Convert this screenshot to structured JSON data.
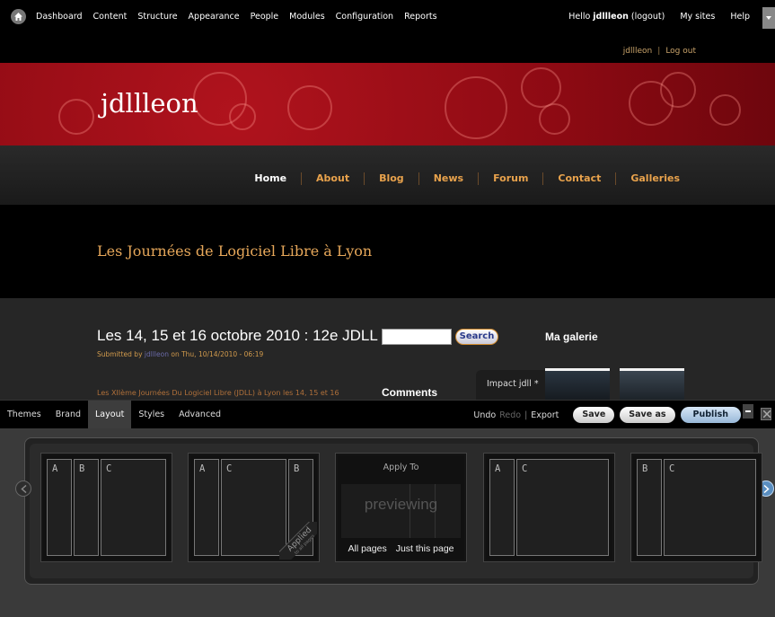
{
  "admin_bar": {
    "menu": [
      "Dashboard",
      "Content",
      "Structure",
      "Appearance",
      "People",
      "Modules",
      "Configuration",
      "Reports"
    ],
    "greeting_prefix": "Hello",
    "username": "jdllleon",
    "logout_paren": "(logout)",
    "my_sites": "My sites",
    "help": "Help"
  },
  "user_links": {
    "user": "jdllleon",
    "separator": "|",
    "logout": "Log out"
  },
  "site": {
    "name": "jdllleon",
    "slogan": "Les Journées de Logiciel Libre à Lyon",
    "nav": [
      "Home",
      "About",
      "Blog",
      "News",
      "Forum",
      "Contact",
      "Galleries"
    ]
  },
  "content": {
    "title": "Les 14, 15 et 16 octobre 2010 : 12e JDLL",
    "submitted_prefix": "Submitted by",
    "submitted_user": "jdllleon",
    "submitted_suffix": "on Thu, 10/14/2010 - 06:19",
    "teaser": "Les XIIème Journées Du Logiciel Libre (JDLL) à Lyon les 14, 15 et 16",
    "search_button": "Search",
    "gallery_title": "Ma galerie",
    "comments_title": "Comments",
    "theme_tab": "Impact jdll *"
  },
  "theme_builder": {
    "tabs": [
      "Themes",
      "Brand",
      "Layout",
      "Styles",
      "Advanced"
    ],
    "active_tab": "Layout",
    "undo": "Undo",
    "redo": "Redo",
    "sep": "|",
    "export": "Export",
    "save": "Save",
    "save_as": "Save as",
    "publish": "Publish",
    "layouts": [
      [
        "A",
        "B",
        "C"
      ],
      [
        "A",
        "C",
        "B"
      ],
      [
        "A",
        "C"
      ],
      [
        "B",
        "C"
      ]
    ],
    "applied_label": "Applied",
    "applied_sub": "to all pages",
    "apply": {
      "title": "Apply To",
      "previewing": "previewing",
      "all_pages": "All pages",
      "this_page": "Just this page"
    }
  },
  "colors": {
    "header_red": "#8d0a13",
    "nav_orange": "#e8a24c",
    "slogan_gold": "#e6a75a",
    "publish_blue": "#98b8d8"
  }
}
